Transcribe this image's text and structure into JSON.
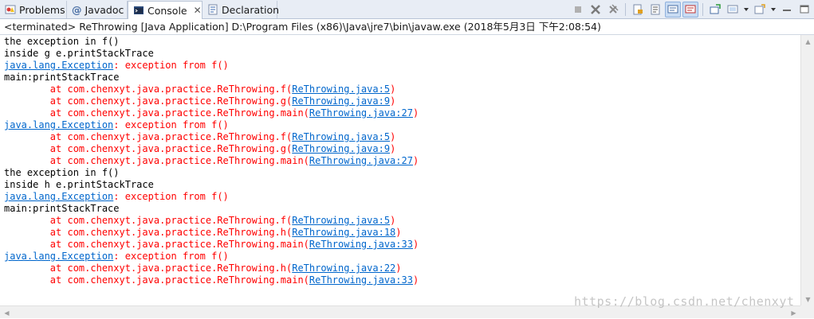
{
  "tabs": [
    {
      "label": "Problems",
      "icon": "problems-icon"
    },
    {
      "label": "Javadoc",
      "icon": "at-icon",
      "glyph": "@"
    },
    {
      "label": "Console",
      "icon": "console-icon",
      "close": "✕"
    },
    {
      "label": "Declaration",
      "icon": "declaration-icon"
    }
  ],
  "toolbar_icons": [
    "terminate-icon",
    "remove-launch-icon",
    "remove-all-terminated-icon",
    "scroll-lock-icon",
    "word-wrap-icon",
    "show-stdout-icon",
    "show-stderr-icon",
    "pin-console-icon",
    "display-selected-console-icon",
    "open-console-icon",
    "minimize-icon",
    "maximize-icon"
  ],
  "process_title": "<terminated> ReThrowing [Java Application] D:\\Program Files (x86)\\Java\\jre7\\bin\\javaw.exe (2018年5月3日 下午2:08:54)",
  "console_lines": [
    {
      "type": "out",
      "text": "the exception in f()"
    },
    {
      "type": "out",
      "text": "inside g e.printStackTrace"
    },
    {
      "type": "exc",
      "link": "java.lang.Exception",
      "rest": ": exception from f()"
    },
    {
      "type": "out",
      "text": "main:printStackTrace"
    },
    {
      "type": "at",
      "prefix": "\tat com.chenxyt.java.practice.ReThrowing.f(",
      "link": "ReThrowing.java:5",
      "suffix": ")"
    },
    {
      "type": "at",
      "prefix": "\tat com.chenxyt.java.practice.ReThrowing.g(",
      "link": "ReThrowing.java:9",
      "suffix": ")"
    },
    {
      "type": "at",
      "prefix": "\tat com.chenxyt.java.practice.ReThrowing.main(",
      "link": "ReThrowing.java:27",
      "suffix": ")"
    },
    {
      "type": "exc",
      "link": "java.lang.Exception",
      "rest": ": exception from f()"
    },
    {
      "type": "at",
      "prefix": "\tat com.chenxyt.java.practice.ReThrowing.f(",
      "link": "ReThrowing.java:5",
      "suffix": ")"
    },
    {
      "type": "at",
      "prefix": "\tat com.chenxyt.java.practice.ReThrowing.g(",
      "link": "ReThrowing.java:9",
      "suffix": ")"
    },
    {
      "type": "at",
      "prefix": "\tat com.chenxyt.java.practice.ReThrowing.main(",
      "link": "ReThrowing.java:27",
      "suffix": ")"
    },
    {
      "type": "out",
      "text": "the exception in f()"
    },
    {
      "type": "out",
      "text": "inside h e.printStackTrace"
    },
    {
      "type": "exc",
      "link": "java.lang.Exception",
      "rest": ": exception from f()"
    },
    {
      "type": "out",
      "text": "main:printStackTrace"
    },
    {
      "type": "at",
      "prefix": "\tat com.chenxyt.java.practice.ReThrowing.f(",
      "link": "ReThrowing.java:5",
      "suffix": ")"
    },
    {
      "type": "at",
      "prefix": "\tat com.chenxyt.java.practice.ReThrowing.h(",
      "link": "ReThrowing.java:18",
      "suffix": ")"
    },
    {
      "type": "at",
      "prefix": "\tat com.chenxyt.java.practice.ReThrowing.main(",
      "link": "ReThrowing.java:33",
      "suffix": ")"
    },
    {
      "type": "exc",
      "link": "java.lang.Exception",
      "rest": ": exception from f()"
    },
    {
      "type": "at",
      "prefix": "\tat com.chenxyt.java.practice.ReThrowing.h(",
      "link": "ReThrowing.java:22",
      "suffix": ")"
    },
    {
      "type": "at",
      "prefix": "\tat com.chenxyt.java.practice.ReThrowing.main(",
      "link": "ReThrowing.java:33",
      "suffix": ")"
    }
  ],
  "watermark": "https://blog.csdn.net/chenxyt",
  "colors": {
    "stdout": "#000000",
    "stderr": "#ff0000",
    "link": "#0066cc",
    "tab_bar": "#e8edf5"
  }
}
